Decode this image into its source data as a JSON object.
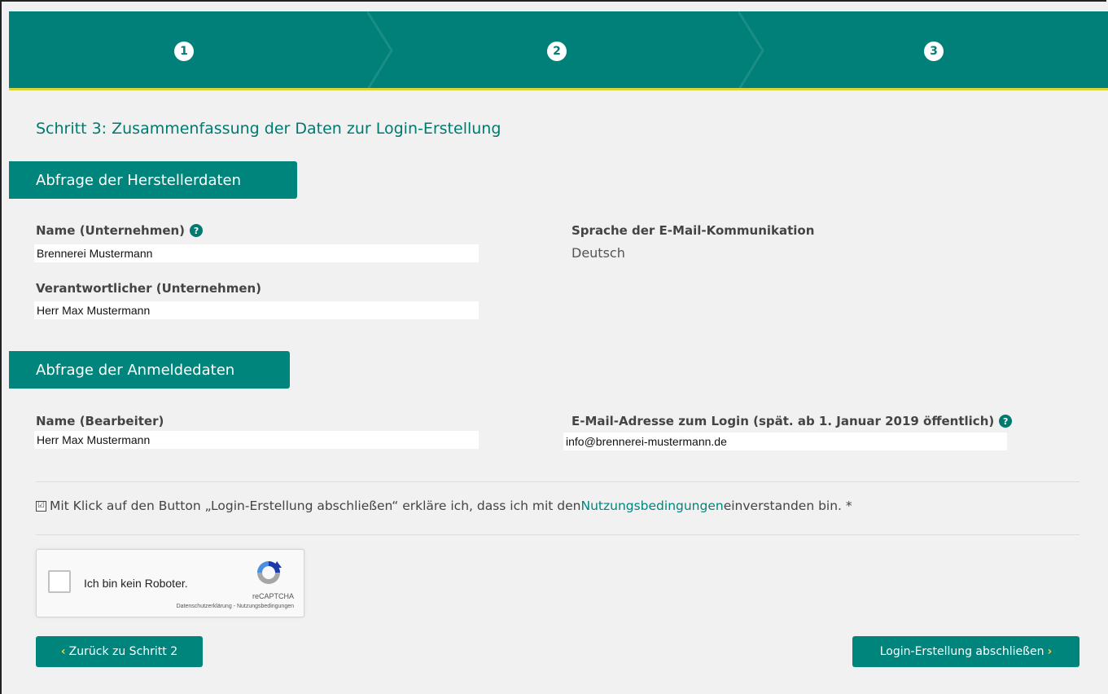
{
  "stepper": {
    "steps": [
      "1",
      "2",
      "3"
    ]
  },
  "page_title": "Schritt 3: Zusammenfassung der Daten zur Login-Erstellung",
  "section_manufacturer": {
    "title": "Abfrage der Herstellerdaten",
    "company_name_label": "Name (Unternehmen)",
    "company_name_value": "Brennerei Mustermann",
    "responsible_label": "Verantwortlicher (Unternehmen)",
    "responsible_value": "Herr Max Mustermann",
    "language_label": "Sprache der E-Mail-Kommunikation",
    "language_value": "Deutsch"
  },
  "section_login": {
    "title": "Abfrage der Anmeldedaten",
    "editor_label": "Name (Bearbeiter)",
    "editor_value": "Herr Max Mustermann",
    "email_label": "E-Mail-Adresse zum Login (spät. ab 1. Januar 2019 öffentlich)",
    "email_value": "info@brennerei-mustermann.de"
  },
  "terms": {
    "checked": true,
    "check_glyph": "☑",
    "text_before": "Mit Klick auf den Button „Login-Erstellung abschließen“ erkläre ich, dass ich mit den ",
    "link": "Nutzungsbedingungen",
    "text_after": " einverstanden bin. *"
  },
  "captcha": {
    "label": "Ich bin kein Roboter.",
    "brand": "reCAPTCHA",
    "links": "Datenschutzerklärung - Nutzungsbedingungen"
  },
  "buttons": {
    "back_label": "Zurück zu Schritt 2",
    "finish_label": "Login-Erstellung abschließen"
  },
  "help_glyph": "?",
  "arrow_left": "‹",
  "arrow_right": "›",
  "colors": {
    "primary": "#008078",
    "accent": "#d8d43a",
    "background": "#f1f1f1"
  }
}
